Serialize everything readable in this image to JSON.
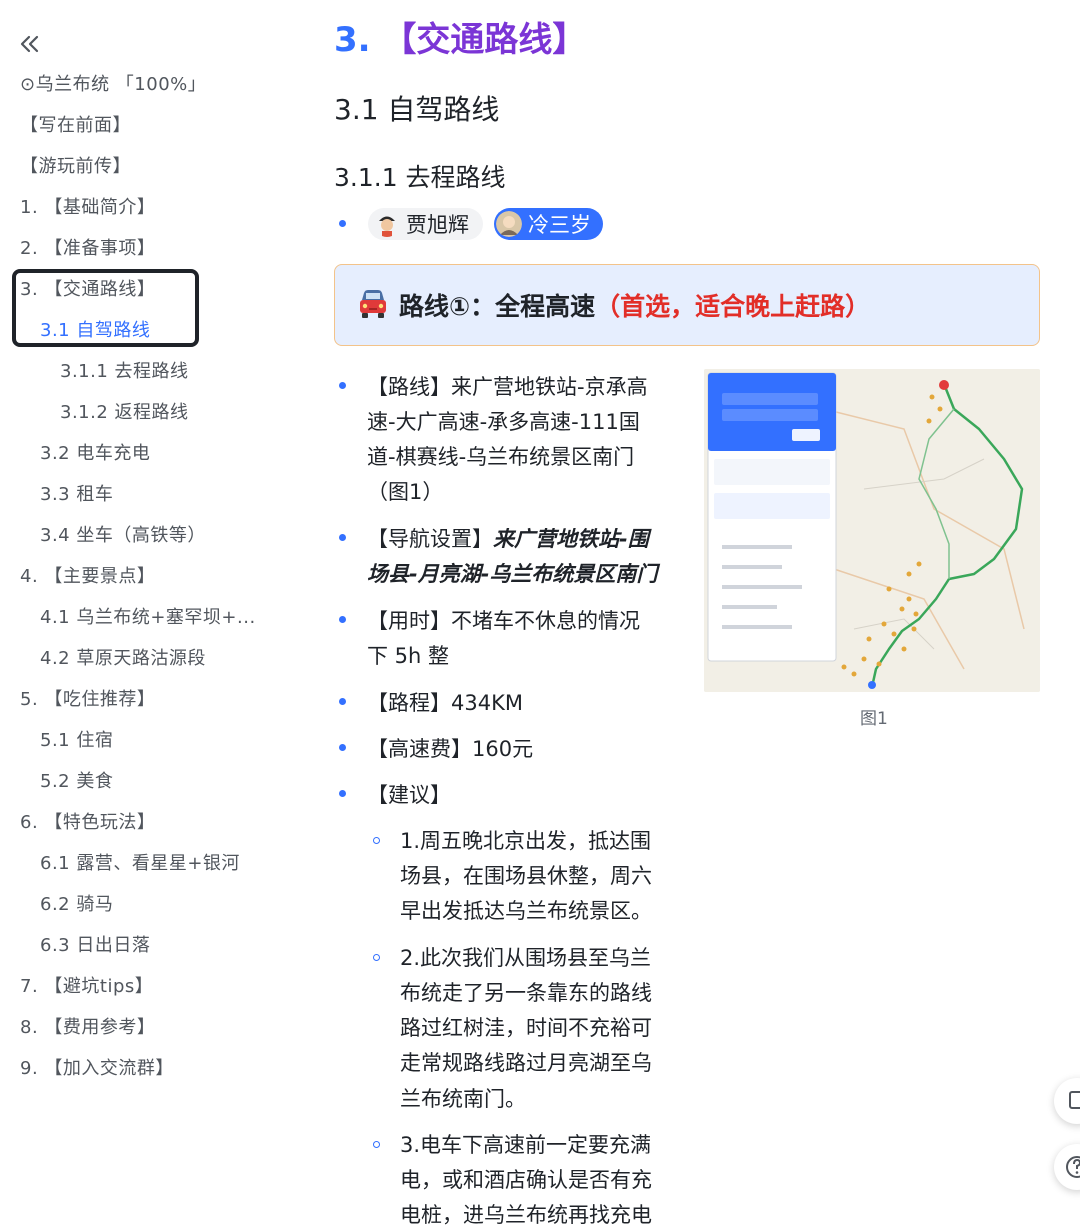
{
  "sidebar": {
    "items": [
      {
        "label": "⊙乌兰布统 「100%」",
        "level": 1
      },
      {
        "label": "【写在前面】",
        "level": 1
      },
      {
        "label": "【游玩前传】",
        "level": 1
      },
      {
        "label": "1. 【基础简介】",
        "level": 1
      },
      {
        "label": "2. 【准备事项】",
        "level": 1
      },
      {
        "label": "3. 【交通路线】",
        "level": 1
      },
      {
        "label": "3.1 自驾路线",
        "level": 2,
        "active": true
      },
      {
        "label": "3.1.1 去程路线",
        "level": 3
      },
      {
        "label": "3.1.2 返程路线",
        "level": 3
      },
      {
        "label": "3.2 电车充电",
        "level": 2
      },
      {
        "label": "3.3 租车",
        "level": 2
      },
      {
        "label": "3.4 坐车（高铁等）",
        "level": 2
      },
      {
        "label": "4. 【主要景点】",
        "level": 1
      },
      {
        "label": "4.1 乌兰布统+塞罕坝+...",
        "level": 2
      },
      {
        "label": "4.2 草原天路沽源段",
        "level": 2
      },
      {
        "label": "5. 【吃住推荐】",
        "level": 1
      },
      {
        "label": "5.1 住宿",
        "level": 2
      },
      {
        "label": "5.2 美食",
        "level": 2
      },
      {
        "label": "6. 【特色玩法】",
        "level": 1
      },
      {
        "label": "6.1 露营、看星星+银河",
        "level": 2
      },
      {
        "label": "6.2 骑马",
        "level": 2
      },
      {
        "label": "6.3 日出日落",
        "level": 2
      },
      {
        "label": "7. 【避坑tips】",
        "level": 1
      },
      {
        "label": "8. 【费用参考】",
        "level": 1
      },
      {
        "label": "9. 【加入交流群】",
        "level": 1
      }
    ]
  },
  "main": {
    "chapter_number": "3.",
    "chapter_title": "【交通路线】",
    "h2": "3.1 自驾路线",
    "h3": "3.1.1 去程路线",
    "mentions": [
      "贾旭辉",
      "冷三岁"
    ],
    "callout": {
      "icon": "car-emoji",
      "title": "路线①：全程高速",
      "highlight": "（首选，适合晚上赶路）"
    },
    "route": {
      "route_lines": [
        "【路线】来广营地铁站-京承高",
        "速-大广高速-承多高速-111国",
        "道-棋赛线-乌兰布统景区南门",
        "（图1）"
      ],
      "nav_label": "【导航设置】",
      "nav_lines": [
        "来广营地铁站-围",
        "场县-月亮湖-乌兰布统景区南门"
      ],
      "time_lines": [
        "【用时】不堵车不休息的情况",
        "下 5h 整"
      ],
      "distance": "【路程】434KM",
      "toll": "【高速费】160元",
      "advice_title": "【建议】",
      "advice": [
        [
          "1.周五晚北京出发，抵达围",
          "场县，在围场县休整，周六",
          "早出发抵达乌兰布统景区。"
        ],
        [
          "2.此次我们从围场县至乌兰",
          "布统走了另一条靠东的路线",
          "路过红树洼，时间不充裕可",
          "走常规路线路过月亮湖至乌",
          "兰布统南门。"
        ],
        [
          "3.电车下高速前一定要充满",
          "电，或和酒店确认是否有充",
          "电桩，进乌兰布统再找充电"
        ]
      ]
    },
    "figure_caption": "图1"
  },
  "colors": {
    "accent": "#3370ff",
    "chapter_bracket": "#7b35d6",
    "highlight_red": "#e22e28",
    "callout_bg": "#e6eefe",
    "callout_border": "#f3c38a",
    "route_line": "#3aa75a"
  }
}
